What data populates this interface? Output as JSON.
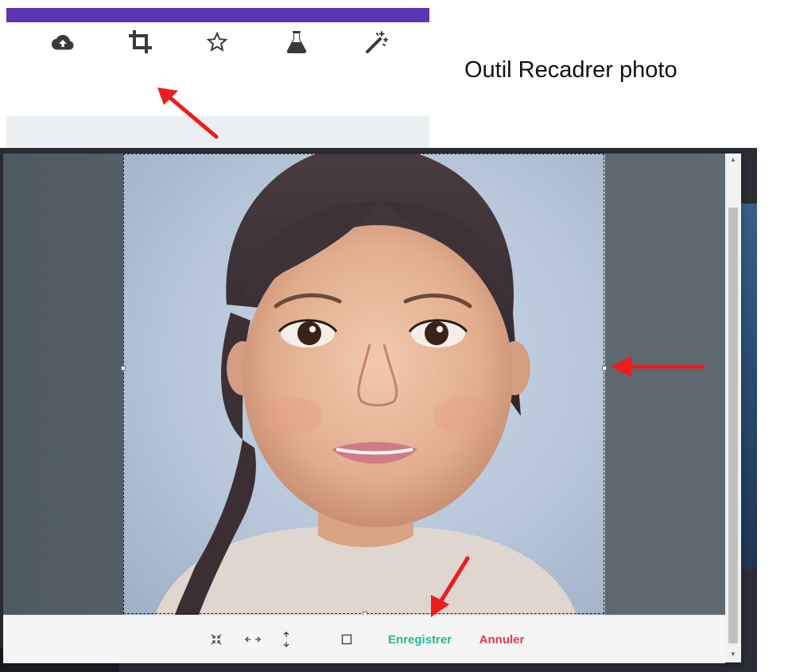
{
  "caption": "Outil Recadrer photo",
  "toolbar": {
    "tools": [
      {
        "icon": "cloud-upload-icon"
      },
      {
        "icon": "crop-icon"
      },
      {
        "icon": "star-icon"
      },
      {
        "icon": "flask-icon"
      },
      {
        "icon": "magic-wand-icon"
      }
    ]
  },
  "modal": {
    "footer": {
      "fit_icon": "compress-icon",
      "width_icon": "horizontal-arrows-icon",
      "height_icon": "vertical-arrows-icon",
      "square_icon": "square-icon",
      "save_label": "Enregistrer",
      "cancel_label": "Annuler"
    }
  },
  "colors": {
    "accent": "#5b35b4",
    "save": "#26b99a",
    "cancel": "#e53950",
    "annotation": "#ee1c1c"
  }
}
